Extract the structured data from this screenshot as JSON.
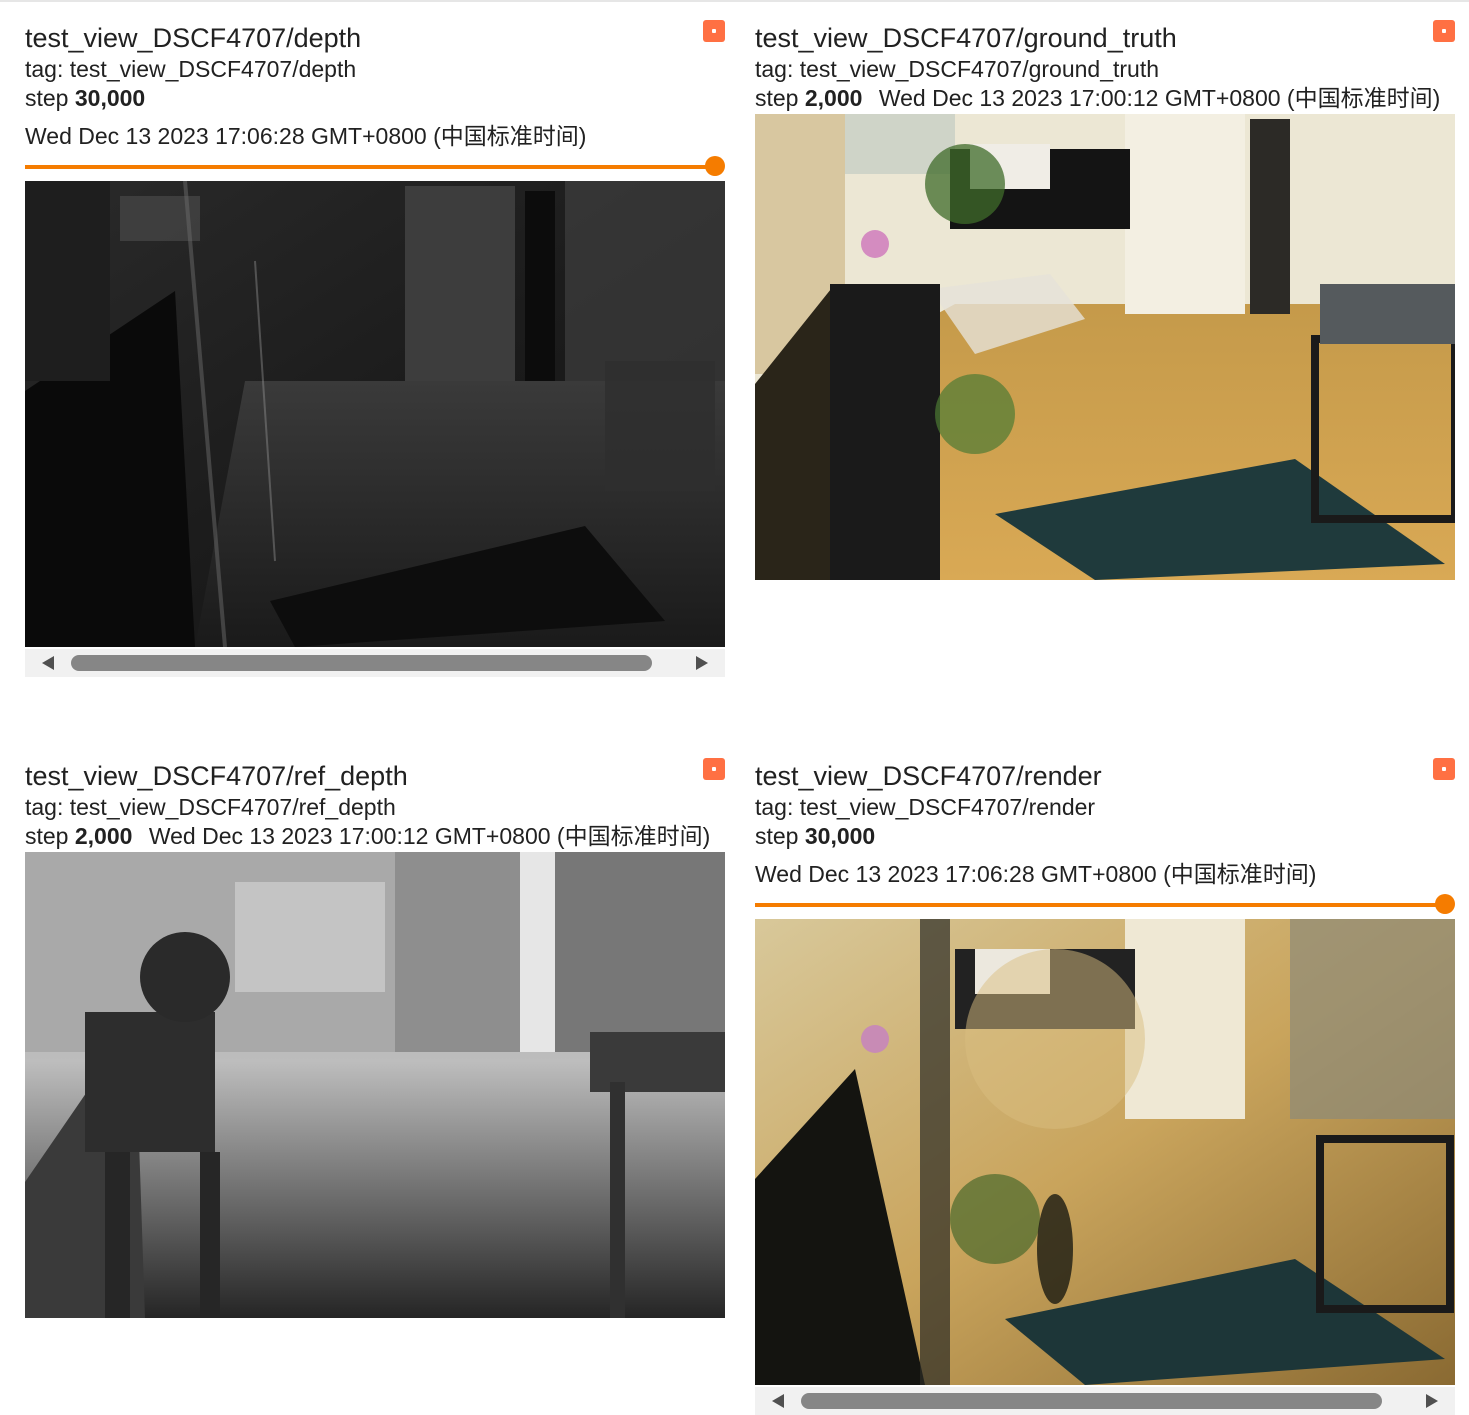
{
  "cards": [
    {
      "title": "test_view_DSCF4707/depth",
      "tag": "tag: test_view_DSCF4707/depth",
      "step_label": "step",
      "step_value": "30,000",
      "timestamp": "Wed Dec 13 2023 17:06:28 GMT+0800 (中国标准时间)",
      "slider_position": 1.0,
      "image_kind": "depth map"
    },
    {
      "title": "test_view_DSCF4707/ground_truth",
      "tag": "tag: test_view_DSCF4707/ground_truth",
      "step_label": "step",
      "step_value": "2,000",
      "timestamp": "Wed Dec 13 2023 17:00:12 GMT+0800 (中国标准时间)",
      "image_kind": "photo"
    },
    {
      "title": "test_view_DSCF4707/ref_depth",
      "tag": "tag: test_view_DSCF4707/ref_depth",
      "step_label": "step",
      "step_value": "2,000",
      "timestamp": "Wed Dec 13 2023 17:00:12 GMT+0800 (中国标准时间)",
      "image_kind": "reference depth map"
    },
    {
      "title": "test_view_DSCF4707/render",
      "tag": "tag: test_view_DSCF4707/render",
      "step_label": "step",
      "step_value": "30,000",
      "timestamp": "Wed Dec 13 2023 17:06:28 GMT+0800 (中国标准时间)",
      "slider_position": 1.0,
      "image_kind": "rendered photo"
    }
  ],
  "colors": {
    "accent": "#f57c00",
    "expand_icon": "#ff7043",
    "text": "#212121",
    "scrollbar_thumb": "#868686"
  },
  "icons": {
    "expand": "expand-icon",
    "scroll_left": "arrow-left-icon",
    "scroll_right": "arrow-right-icon"
  }
}
